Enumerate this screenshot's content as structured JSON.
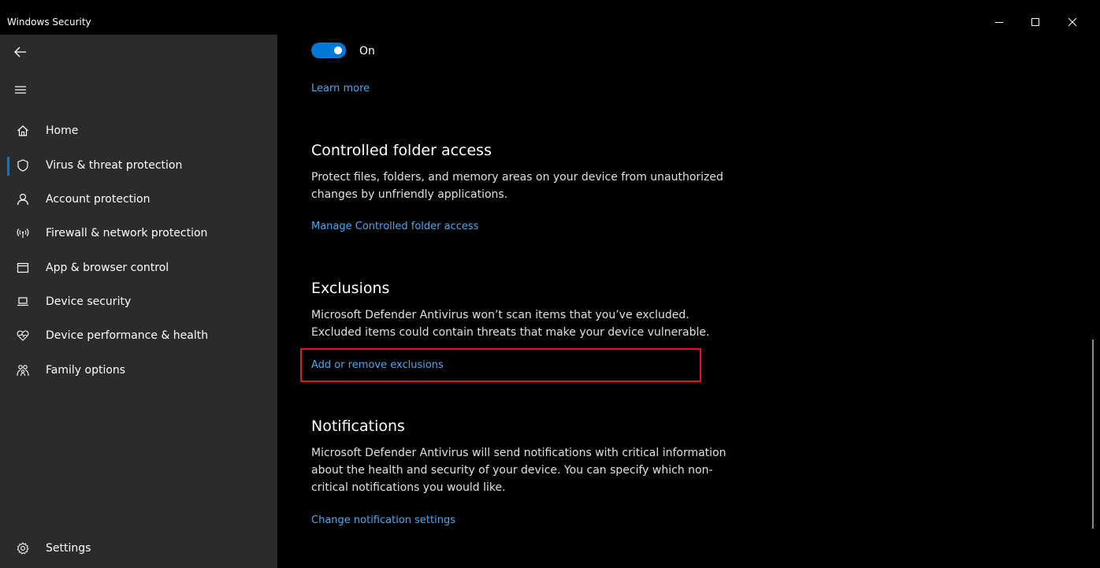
{
  "window": {
    "title": "Windows Security",
    "controls": {
      "minimize": "minimize-icon",
      "maximize": "maximize-icon",
      "close": "close-icon"
    }
  },
  "sidebar": {
    "back": "back-arrow-icon",
    "menu": "hamburger-icon",
    "items": [
      {
        "label": "Home",
        "icon": "home-icon",
        "active": false
      },
      {
        "label": "Virus & threat protection",
        "icon": "shield-icon",
        "active": true
      },
      {
        "label": "Account protection",
        "icon": "person-icon",
        "active": false
      },
      {
        "label": "Firewall & network protection",
        "icon": "wireless-icon",
        "active": false
      },
      {
        "label": "App & browser control",
        "icon": "browser-window-icon",
        "active": false
      },
      {
        "label": "Device security",
        "icon": "laptop-icon",
        "active": false
      },
      {
        "label": "Device performance & health",
        "icon": "heart-pulse-icon",
        "active": false
      },
      {
        "label": "Family options",
        "icon": "family-icon",
        "active": false
      }
    ],
    "settings": {
      "label": "Settings",
      "icon": "gear-icon"
    }
  },
  "main": {
    "toggle": {
      "state": "On",
      "checked": true
    },
    "learn_more": "Learn more",
    "controlled_folder": {
      "title": "Controlled folder access",
      "description": "Protect files, folders, and memory areas on your device from unauthorized changes by unfriendly applications.",
      "link": "Manage Controlled folder access"
    },
    "exclusions": {
      "title": "Exclusions",
      "description": "Microsoft Defender Antivirus won’t scan items that you’ve excluded. Excluded items could contain threats that make your device vulnerable.",
      "link": "Add or remove exclusions"
    },
    "notifications": {
      "title": "Notifications",
      "description": "Microsoft Defender Antivirus will send notifications with critical information about the health and security of your device. You can specify which non-critical notifications you would like.",
      "link": "Change notification settings"
    }
  },
  "colors": {
    "accent": "#0078d7",
    "link": "#4ca8ee",
    "highlight": "#e81123",
    "sidebar_bg": "#2b2b2b",
    "main_bg": "#000000"
  }
}
